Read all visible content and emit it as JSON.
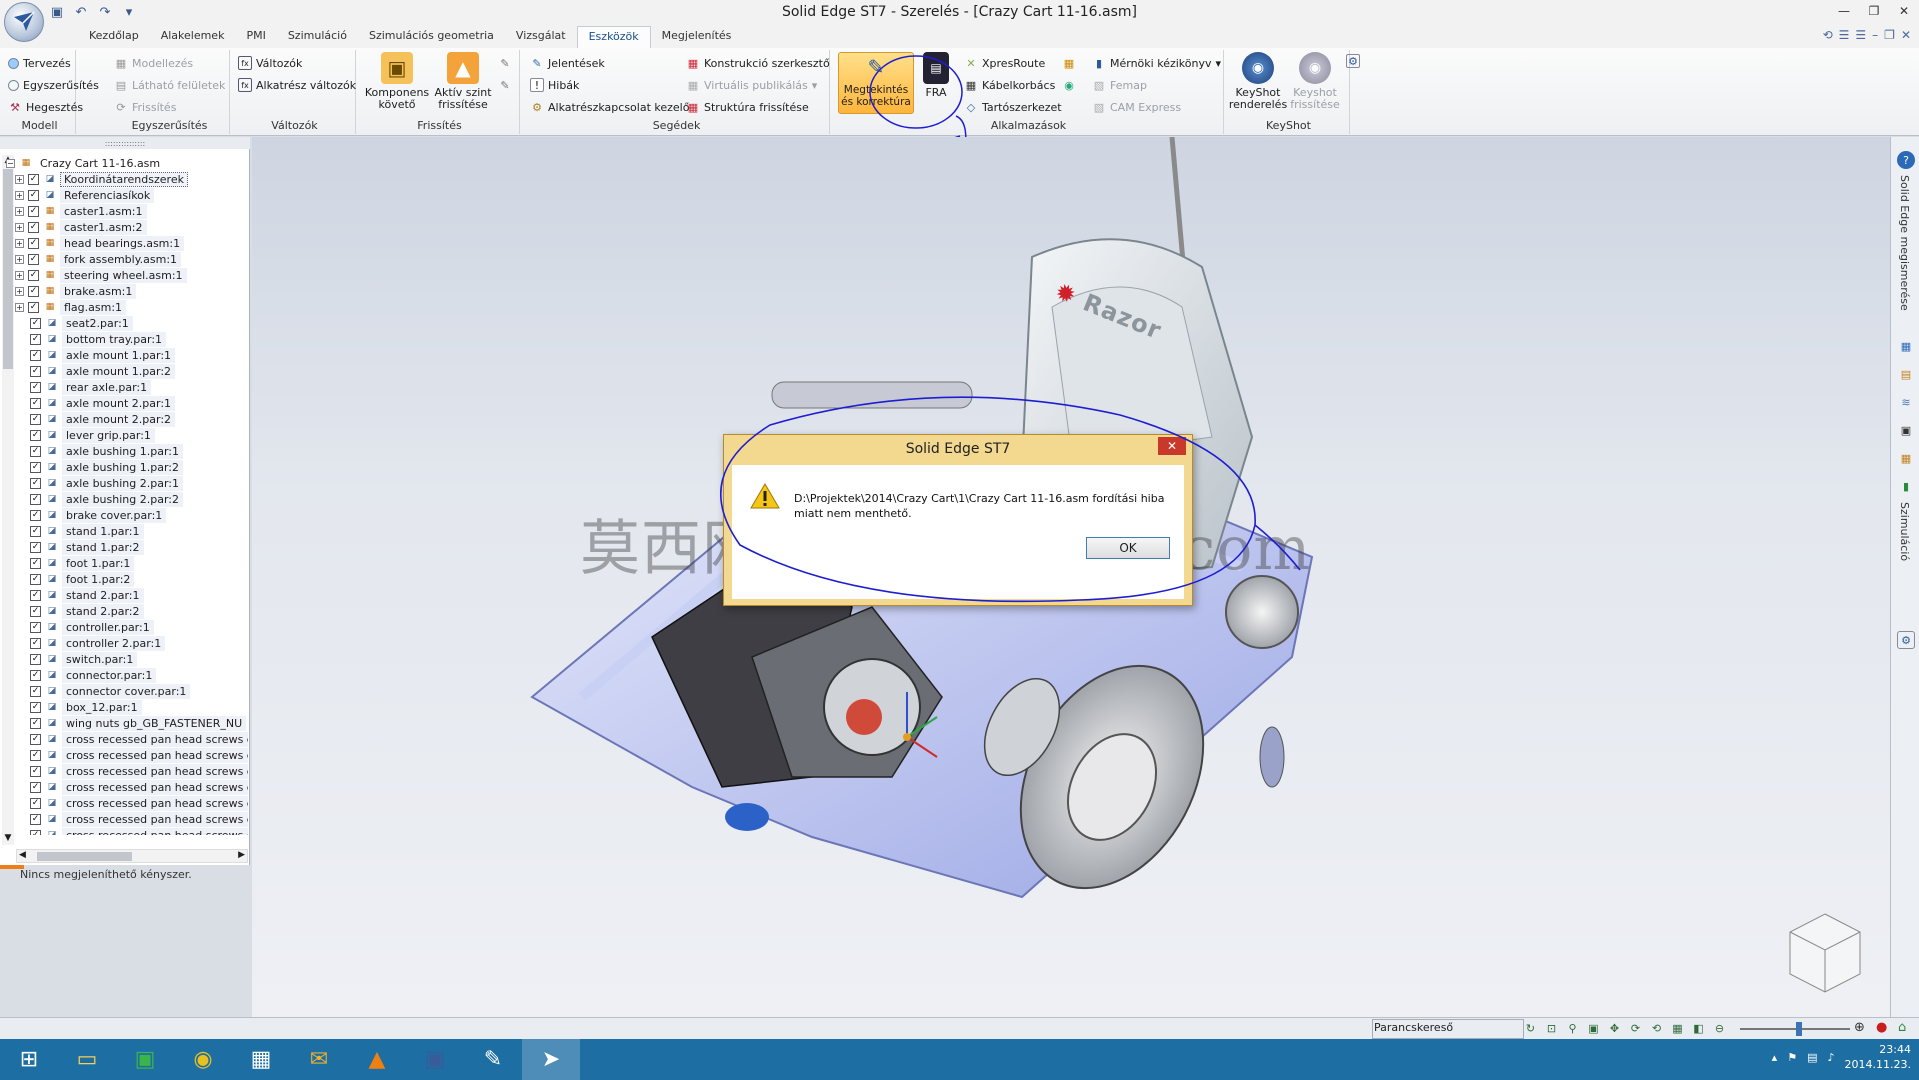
{
  "window": {
    "title": "Solid Edge ST7 - Szerelés - [Crazy Cart 11-16.asm]"
  },
  "tabs": [
    "Kezdőlap",
    "Alakelemek",
    "PMI",
    "Szimuláció",
    "Szimulációs geometria",
    "Vizsgálat",
    "Eszközök",
    "Megjelenítés"
  ],
  "active_tab": "Eszközök",
  "ribbon": {
    "modell": {
      "label": "Modell",
      "items": [
        "Tervezés",
        "Egyszerűsítés",
        "Hegesztés"
      ]
    },
    "egyszerusites": {
      "label": "Egyszerűsítés",
      "items": [
        "Modellezés",
        "Látható felületek",
        "Frissítés"
      ]
    },
    "valtozok": {
      "label": "Változók",
      "items": [
        "Változók",
        "Alkatrész változók"
      ]
    },
    "frissites": {
      "label": "Frissítés",
      "items": [
        "Komponens követő",
        "Aktív szint frissítése"
      ]
    },
    "segedek": {
      "label": "Segédek",
      "items": [
        "Jelentések",
        "Hibák",
        "Alkatrészkapcsolat kezelő",
        "Konstrukció szerkesztő",
        "Virtuális publikálás",
        "Struktúra frissítése"
      ]
    },
    "alkalmazasok": {
      "label": "Alkalmazások",
      "items": [
        "Megtekintés és korrektúra",
        "FRA",
        "XpresRoute",
        "Kábelkorbács",
        "Tartószerkezet",
        "Mérnöki kézikönyv",
        "Femap",
        "CAM Express"
      ]
    },
    "keyshot": {
      "label": "KeyShot",
      "items": [
        "KeyShot renderelés",
        "Keyshot frissítése"
      ]
    }
  },
  "tree": {
    "root": "Crazy Cart 11-16.asm",
    "items": [
      {
        "label": "Koordinátarendszerek",
        "expand": true
      },
      {
        "label": "Referenciasíkok",
        "expand": true
      },
      {
        "label": "caster1.asm:1",
        "expand": true
      },
      {
        "label": "caster1.asm:2",
        "expand": true
      },
      {
        "label": "head bearings.asm:1",
        "expand": true
      },
      {
        "label": "fork assembly.asm:1",
        "expand": true
      },
      {
        "label": "steering wheel.asm:1",
        "expand": true
      },
      {
        "label": "brake.asm:1",
        "expand": true
      },
      {
        "label": "flag.asm:1",
        "expand": true
      },
      {
        "label": "seat2.par:1"
      },
      {
        "label": "bottom tray.par:1"
      },
      {
        "label": "axle mount 1.par:1"
      },
      {
        "label": "axle mount 1.par:2"
      },
      {
        "label": "rear axle.par:1"
      },
      {
        "label": "axle mount 2.par:1"
      },
      {
        "label": "axle mount 2.par:2"
      },
      {
        "label": "lever grip.par:1"
      },
      {
        "label": "axle bushing 1.par:1"
      },
      {
        "label": "axle bushing 1.par:2"
      },
      {
        "label": "axle bushing 2.par:1"
      },
      {
        "label": "axle bushing 2.par:2"
      },
      {
        "label": "brake cover.par:1"
      },
      {
        "label": "stand 1.par:1"
      },
      {
        "label": "stand 1.par:2"
      },
      {
        "label": "foot 1.par:1"
      },
      {
        "label": "foot 1.par:2"
      },
      {
        "label": "stand 2.par:1"
      },
      {
        "label": "stand 2.par:2"
      },
      {
        "label": "controller.par:1"
      },
      {
        "label": "controller 2.par:1"
      },
      {
        "label": "switch.par:1"
      },
      {
        "label": "connector.par:1"
      },
      {
        "label": "connector cover.par:1"
      },
      {
        "label": "box_12.par:1"
      },
      {
        "label": "wing nuts gb_GB_FASTENER_NU"
      },
      {
        "label": "cross recessed pan head screws g"
      },
      {
        "label": "cross recessed pan head screws g"
      },
      {
        "label": "cross recessed pan head screws g"
      },
      {
        "label": "cross recessed pan head screws g"
      },
      {
        "label": "cross recessed pan head screws g"
      },
      {
        "label": "cross recessed pan head screws g"
      },
      {
        "label": "cross recessed pan head screws g"
      }
    ]
  },
  "panel_status": "Nincs megjeleníthető kényszer.",
  "dialog": {
    "title": "Solid Edge ST7",
    "message_line1": "D:\\Projektek\\2014\\Crazy Cart\\1\\Crazy Cart 11-16.asm fordítási hiba",
    "message_line2": "miatt nem menthető.",
    "ok": "OK"
  },
  "model": {
    "brand": "Razor"
  },
  "watermark": "莫西网www. 3dmox.com",
  "rightbar": {
    "label1": "Solid Edge megismerése",
    "label2": "Szimuláció"
  },
  "statusbar": {
    "command_finder": "Parancskereső",
    "zoom_level": 0.5
  },
  "taskbar": {
    "time": "23:44",
    "date": "2014.11.23."
  },
  "colors": {
    "accent": "#1a4e8a",
    "taskbar": "#1d6ea3",
    "dialog_frame": "#f3d88f",
    "annotation_ink": "#1e1ed0"
  }
}
